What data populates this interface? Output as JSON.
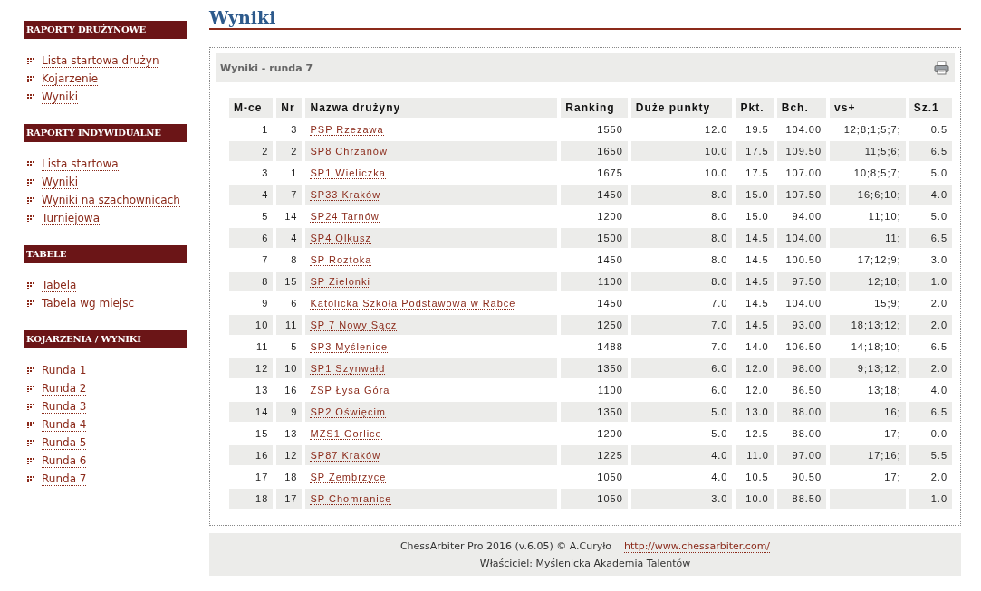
{
  "sidebar": {
    "sections": [
      {
        "title": "RAPORTY DRUŻYNOWE",
        "items": [
          "Lista startowa drużyn",
          "Kojarzenie",
          "Wyniki"
        ]
      },
      {
        "title": "RAPORTY INDYWIDUALNE",
        "items": [
          "Lista startowa",
          "Wyniki",
          "Wyniki na szachownicach",
          "Turniejowa"
        ]
      },
      {
        "title": "TABELE",
        "items": [
          "Tabela",
          "Tabela wg miejsc"
        ]
      },
      {
        "title": "KOJARZENIA / WYNIKI",
        "items": [
          "Runda 1",
          "Runda 2",
          "Runda 3",
          "Runda 4",
          "Runda 5",
          "Runda 6",
          "Runda 7"
        ]
      }
    ]
  },
  "page_title": "Wyniki",
  "panel": {
    "title": "Wyniki - runda 7"
  },
  "table": {
    "columns": [
      "M-ce",
      "Nr",
      "Nazwa drużyny",
      "Ranking",
      "Duże punkty",
      "Pkt.",
      "Bch.",
      "vs+",
      "Sz.1"
    ],
    "rows": [
      [
        "1",
        "3",
        "PSP Rzezawa",
        "1550",
        "12.0",
        "19.5",
        "104.00",
        "12;8;1;5;7;",
        "0.5"
      ],
      [
        "2",
        "2",
        "SP8 Chrzanów",
        "1650",
        "10.0",
        "17.5",
        "109.50",
        "11;5;6;",
        "6.5"
      ],
      [
        "3",
        "1",
        "SP1 Wieliczka",
        "1675",
        "10.0",
        "17.5",
        "107.00",
        "10;8;5;7;",
        "5.0"
      ],
      [
        "4",
        "7",
        "SP33 Kraków",
        "1450",
        "8.0",
        "15.0",
        "107.50",
        "16;6;10;",
        "4.0"
      ],
      [
        "5",
        "14",
        "SP24 Tarnów",
        "1200",
        "8.0",
        "15.0",
        "94.00",
        "11;10;",
        "5.0"
      ],
      [
        "6",
        "4",
        "SP4 Olkusz",
        "1500",
        "8.0",
        "14.5",
        "104.00",
        "11;",
        "6.5"
      ],
      [
        "7",
        "8",
        "SP Roztoka",
        "1450",
        "8.0",
        "14.5",
        "100.50",
        "17;12;9;",
        "3.0"
      ],
      [
        "8",
        "15",
        "SP Zielonki",
        "1100",
        "8.0",
        "14.5",
        "97.50",
        "12;18;",
        "1.0"
      ],
      [
        "9",
        "6",
        "Katolicka Szkoła Podstawowa w Rabce",
        "1450",
        "7.0",
        "14.5",
        "104.00",
        "15;9;",
        "2.0"
      ],
      [
        "10",
        "11",
        "SP 7 Nowy Sącz",
        "1250",
        "7.0",
        "14.5",
        "93.00",
        "18;13;12;",
        "2.0"
      ],
      [
        "11",
        "5",
        "SP3 Myślenice",
        "1488",
        "7.0",
        "14.0",
        "106.50",
        "14;18;10;",
        "6.5"
      ],
      [
        "12",
        "10",
        "SP1 Szynwałd",
        "1350",
        "6.0",
        "12.0",
        "98.00",
        "9;13;12;",
        "2.0"
      ],
      [
        "13",
        "16",
        "ZSP Łysa Góra",
        "1100",
        "6.0",
        "12.0",
        "86.50",
        "13;18;",
        "4.0"
      ],
      [
        "14",
        "9",
        "SP2 Oświęcim",
        "1350",
        "5.0",
        "13.0",
        "88.00",
        "16;",
        "6.5"
      ],
      [
        "15",
        "13",
        "MZS1 Gorlice",
        "1200",
        "5.0",
        "12.5",
        "88.00",
        "17;",
        "0.0"
      ],
      [
        "16",
        "12",
        "SP87 Kraków",
        "1225",
        "4.0",
        "11.0",
        "97.00",
        "17;16;",
        "5.5"
      ],
      [
        "17",
        "18",
        "SP Zembrzyce",
        "1050",
        "4.0",
        "10.5",
        "90.50",
        "17;",
        "2.0"
      ],
      [
        "18",
        "17",
        "SP Chomranice",
        "1050",
        "3.0",
        "10.0",
        "88.50",
        "",
        "1.0"
      ]
    ]
  },
  "footer": {
    "credit": "ChessArbiter Pro 2016 (v.6.05) © A.Curyło",
    "link": "http://www.chessarbiter.com/",
    "owner": "Właściciel: Myślenicka Akademia Talentów"
  }
}
